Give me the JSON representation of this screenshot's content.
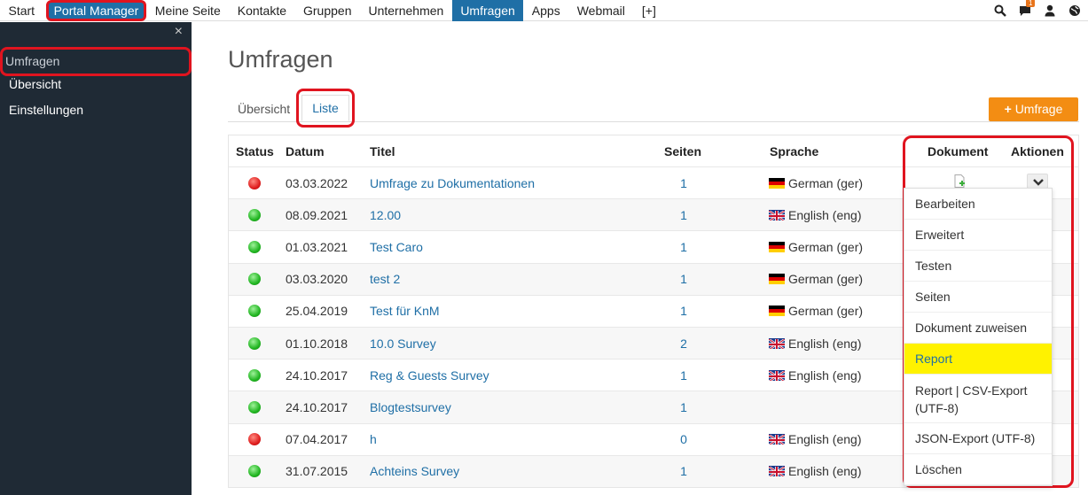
{
  "topnav": {
    "items": [
      "Start",
      "Portal Manager",
      "Meine Seite",
      "Kontakte",
      "Gruppen",
      "Unternehmen",
      "Umfragen",
      "Apps",
      "Webmail",
      "[+]"
    ],
    "active": "Umfragen",
    "notification_count": "1",
    "colors": {
      "active_bg": "#1f6fa6",
      "highlight_frame": "#e0141f"
    },
    "icons": [
      "search-icon",
      "chat-icon",
      "user-icon",
      "globe-icon"
    ]
  },
  "sidebar": {
    "close_glyph": "×",
    "title": "Umfragen",
    "items": [
      "Übersicht",
      "Einstellungen"
    ]
  },
  "main": {
    "title": "Umfragen",
    "tabs": [
      "Übersicht",
      "Liste"
    ],
    "active_tab": "Liste",
    "add_button_label": "Umfrage",
    "add_button_glyph": "+"
  },
  "table": {
    "headers": {
      "status": "Status",
      "date": "Datum",
      "title": "Titel",
      "pages": "Seiten",
      "language": "Sprache",
      "document": "Dokument",
      "actions": "Aktionen"
    },
    "rows": [
      {
        "status": "red",
        "date": "03.03.2022",
        "title": "Umfrage zu Dokumentationen",
        "pages": "1",
        "flag": "de",
        "language": "German (ger)"
      },
      {
        "status": "green",
        "date": "08.09.2021",
        "title": "12.00",
        "pages": "1",
        "flag": "uk",
        "language": "English (eng)"
      },
      {
        "status": "green",
        "date": "01.03.2021",
        "title": "Test Caro",
        "pages": "1",
        "flag": "de",
        "language": "German (ger)"
      },
      {
        "status": "green",
        "date": "03.03.2020",
        "title": "test 2",
        "pages": "1",
        "flag": "de",
        "language": "German (ger)"
      },
      {
        "status": "green",
        "date": "25.04.2019",
        "title": "Test für KnM",
        "pages": "1",
        "flag": "de",
        "language": "German (ger)"
      },
      {
        "status": "green",
        "date": "01.10.2018",
        "title": "10.0 Survey",
        "pages": "2",
        "flag": "uk",
        "language": "English (eng)"
      },
      {
        "status": "green",
        "date": "24.10.2017",
        "title": "Reg & Guests Survey",
        "pages": "1",
        "flag": "uk",
        "language": "English (eng)"
      },
      {
        "status": "green",
        "date": "24.10.2017",
        "title": "Blogtestsurvey",
        "pages": "1",
        "flag": "",
        "language": ""
      },
      {
        "status": "red",
        "date": "07.04.2017",
        "title": "h",
        "pages": "0",
        "flag": "uk",
        "language": "English (eng)"
      },
      {
        "status": "green",
        "date": "31.07.2015",
        "title": "Achteins Survey",
        "pages": "1",
        "flag": "uk",
        "language": "English (eng)"
      }
    ]
  },
  "dropdown": {
    "items": [
      "Bearbeiten",
      "Erweitert",
      "Testen",
      "Seiten",
      "Dokument zuweisen",
      "Report",
      "Report | CSV-Export (UTF-8)",
      "JSON-Export (UTF-8)",
      "Löschen"
    ],
    "highlighted": "Report",
    "highlight_color": "#fff200"
  }
}
